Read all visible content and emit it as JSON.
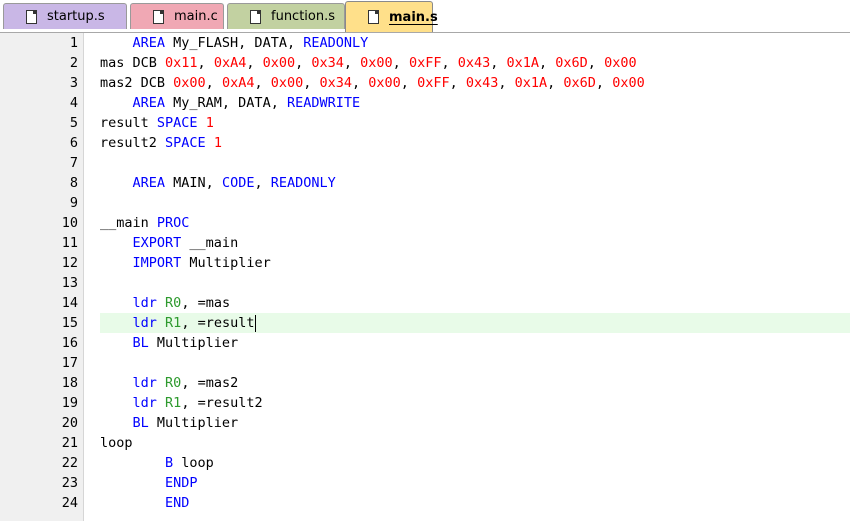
{
  "tabs": [
    {
      "name": "tab-startup-s",
      "label": "startup.s",
      "bg": "#c9b7e6",
      "active": false
    },
    {
      "name": "tab-main-c",
      "label": "main.c",
      "bg": "#f0a8b4",
      "active": false
    },
    {
      "name": "tab-function-s",
      "label": "function.s",
      "bg": "#c2d1a1",
      "active": false
    },
    {
      "name": "tab-main-s",
      "label": "main.s",
      "bg": "#ffe08a",
      "active": true
    }
  ],
  "tab_icon": "document-icon",
  "colors": {
    "keyword": "#0000ff",
    "number": "#ff0000",
    "register": "#2e9a2e",
    "current_line": "#e8fbe8",
    "gutter": "#f0f0f0"
  },
  "editor": {
    "current_line": 15,
    "lines": [
      {
        "n": "1",
        "tokens": [
          [
            "p",
            "    "
          ],
          [
            "k",
            "AREA"
          ],
          [
            "p",
            " My_FLASH, DATA, "
          ],
          [
            "k",
            "READONLY"
          ]
        ]
      },
      {
        "n": "2",
        "tokens": [
          [
            "p",
            "mas DCB "
          ],
          [
            "n",
            "0x11"
          ],
          [
            "p",
            ", "
          ],
          [
            "n",
            "0xA4"
          ],
          [
            "p",
            ", "
          ],
          [
            "n",
            "0x00"
          ],
          [
            "p",
            ", "
          ],
          [
            "n",
            "0x34"
          ],
          [
            "p",
            ", "
          ],
          [
            "n",
            "0x00"
          ],
          [
            "p",
            ", "
          ],
          [
            "n",
            "0xFF"
          ],
          [
            "p",
            ", "
          ],
          [
            "n",
            "0x43"
          ],
          [
            "p",
            ", "
          ],
          [
            "n",
            "0x1A"
          ],
          [
            "p",
            ", "
          ],
          [
            "n",
            "0x6D"
          ],
          [
            "p",
            ", "
          ],
          [
            "n",
            "0x00"
          ]
        ]
      },
      {
        "n": "3",
        "tokens": [
          [
            "p",
            "mas2 DCB "
          ],
          [
            "n",
            "0x00"
          ],
          [
            "p",
            ", "
          ],
          [
            "n",
            "0xA4"
          ],
          [
            "p",
            ", "
          ],
          [
            "n",
            "0x00"
          ],
          [
            "p",
            ", "
          ],
          [
            "n",
            "0x34"
          ],
          [
            "p",
            ", "
          ],
          [
            "n",
            "0x00"
          ],
          [
            "p",
            ", "
          ],
          [
            "n",
            "0xFF"
          ],
          [
            "p",
            ", "
          ],
          [
            "n",
            "0x43"
          ],
          [
            "p",
            ", "
          ],
          [
            "n",
            "0x1A"
          ],
          [
            "p",
            ", "
          ],
          [
            "n",
            "0x6D"
          ],
          [
            "p",
            ", "
          ],
          [
            "n",
            "0x00"
          ]
        ]
      },
      {
        "n": "4",
        "tokens": [
          [
            "p",
            "    "
          ],
          [
            "k",
            "AREA"
          ],
          [
            "p",
            " My_RAM, DATA, "
          ],
          [
            "k",
            "READWRITE"
          ]
        ]
      },
      {
        "n": "5",
        "tokens": [
          [
            "p",
            "result "
          ],
          [
            "k",
            "SPACE"
          ],
          [
            "p",
            " "
          ],
          [
            "n",
            "1"
          ]
        ]
      },
      {
        "n": "6",
        "tokens": [
          [
            "p",
            "result2 "
          ],
          [
            "k",
            "SPACE"
          ],
          [
            "p",
            " "
          ],
          [
            "n",
            "1"
          ]
        ]
      },
      {
        "n": "7",
        "tokens": []
      },
      {
        "n": "8",
        "tokens": [
          [
            "p",
            "    "
          ],
          [
            "k",
            "AREA"
          ],
          [
            "p",
            " MAIN, "
          ],
          [
            "k",
            "CODE"
          ],
          [
            "p",
            ", "
          ],
          [
            "k",
            "READONLY"
          ]
        ]
      },
      {
        "n": "9",
        "tokens": []
      },
      {
        "n": "10",
        "tokens": [
          [
            "p",
            "__main "
          ],
          [
            "k",
            "PROC"
          ]
        ]
      },
      {
        "n": "11",
        "tokens": [
          [
            "p",
            "    "
          ],
          [
            "k",
            "EXPORT"
          ],
          [
            "p",
            " __main"
          ]
        ]
      },
      {
        "n": "12",
        "tokens": [
          [
            "p",
            "    "
          ],
          [
            "k",
            "IMPORT"
          ],
          [
            "p",
            " Multiplier"
          ]
        ]
      },
      {
        "n": "13",
        "tokens": []
      },
      {
        "n": "14",
        "tokens": [
          [
            "p",
            "    "
          ],
          [
            "k",
            "ldr"
          ],
          [
            "p",
            " "
          ],
          [
            "r",
            "R0"
          ],
          [
            "p",
            ", =mas"
          ]
        ]
      },
      {
        "n": "15",
        "tokens": [
          [
            "p",
            "    "
          ],
          [
            "k",
            "ldr"
          ],
          [
            "p",
            " "
          ],
          [
            "r",
            "R1"
          ],
          [
            "p",
            ", =result"
          ]
        ]
      },
      {
        "n": "16",
        "tokens": [
          [
            "p",
            "    "
          ],
          [
            "k",
            "BL"
          ],
          [
            "p",
            " Multiplier"
          ]
        ]
      },
      {
        "n": "17",
        "tokens": []
      },
      {
        "n": "18",
        "tokens": [
          [
            "p",
            "    "
          ],
          [
            "k",
            "ldr"
          ],
          [
            "p",
            " "
          ],
          [
            "r",
            "R0"
          ],
          [
            "p",
            ", =mas2"
          ]
        ]
      },
      {
        "n": "19",
        "tokens": [
          [
            "p",
            "    "
          ],
          [
            "k",
            "ldr"
          ],
          [
            "p",
            " "
          ],
          [
            "r",
            "R1"
          ],
          [
            "p",
            ", =result2"
          ]
        ]
      },
      {
        "n": "20",
        "tokens": [
          [
            "p",
            "    "
          ],
          [
            "k",
            "BL"
          ],
          [
            "p",
            " Multiplier"
          ]
        ]
      },
      {
        "n": "21",
        "tokens": [
          [
            "p",
            "loop"
          ]
        ]
      },
      {
        "n": "22",
        "tokens": [
          [
            "p",
            "        "
          ],
          [
            "k",
            "B"
          ],
          [
            "p",
            " loop"
          ]
        ]
      },
      {
        "n": "23",
        "tokens": [
          [
            "p",
            "        "
          ],
          [
            "k",
            "ENDP"
          ]
        ]
      },
      {
        "n": "24",
        "tokens": [
          [
            "p",
            "        "
          ],
          [
            "k",
            "END"
          ]
        ]
      }
    ]
  }
}
